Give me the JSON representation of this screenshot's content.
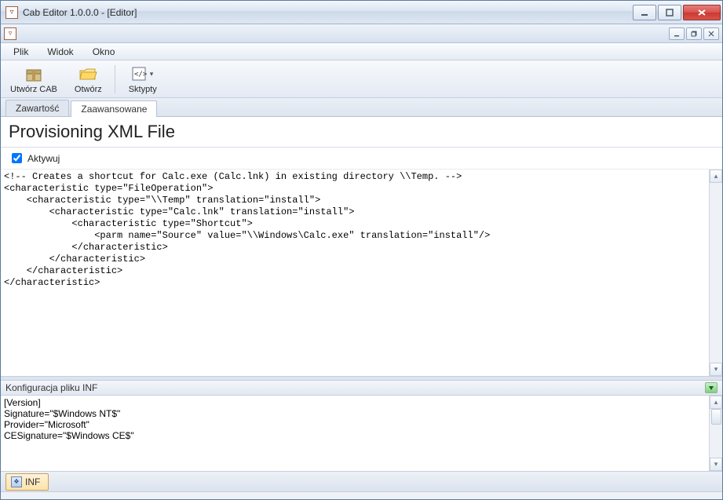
{
  "window": {
    "title": "Cab Editor 1.0.0.0 - [Editor]"
  },
  "menu": {
    "file": "Plik",
    "view": "Widok",
    "window": "Okno"
  },
  "toolbar": {
    "create_cab": "Utwórz CAB",
    "open": "Otwórz",
    "scripts": "Sktypty"
  },
  "tabs": {
    "content": "Zawartość",
    "advanced": "Zaawansowane"
  },
  "section": {
    "title": "Provisioning XML File",
    "activate_label": "Aktywuj",
    "activate_checked": true
  },
  "editor": {
    "text": "<!-- Creates a shortcut for Calc.exe (Calc.lnk) in existing directory \\\\Temp. -->\n<characteristic type=\"FileOperation\">\n    <characteristic type=\"\\\\Temp\" translation=\"install\">\n        <characteristic type=\"Calc.lnk\" translation=\"install\">\n            <characteristic type=\"Shortcut\">\n                <parm name=\"Source\" value=\"\\\\Windows\\Calc.exe\" translation=\"install\"/>\n            </characteristic>\n        </characteristic>\n    </characteristic>\n</characteristic>"
  },
  "lower": {
    "title": "Konfiguracja pliku INF",
    "text": "[Version]\nSignature=\"$Windows NT$\"\nProvider=\"Microsoft\"\nCESignature=\"$Windows CE$\""
  },
  "bottom_tab": {
    "label": "INF"
  }
}
